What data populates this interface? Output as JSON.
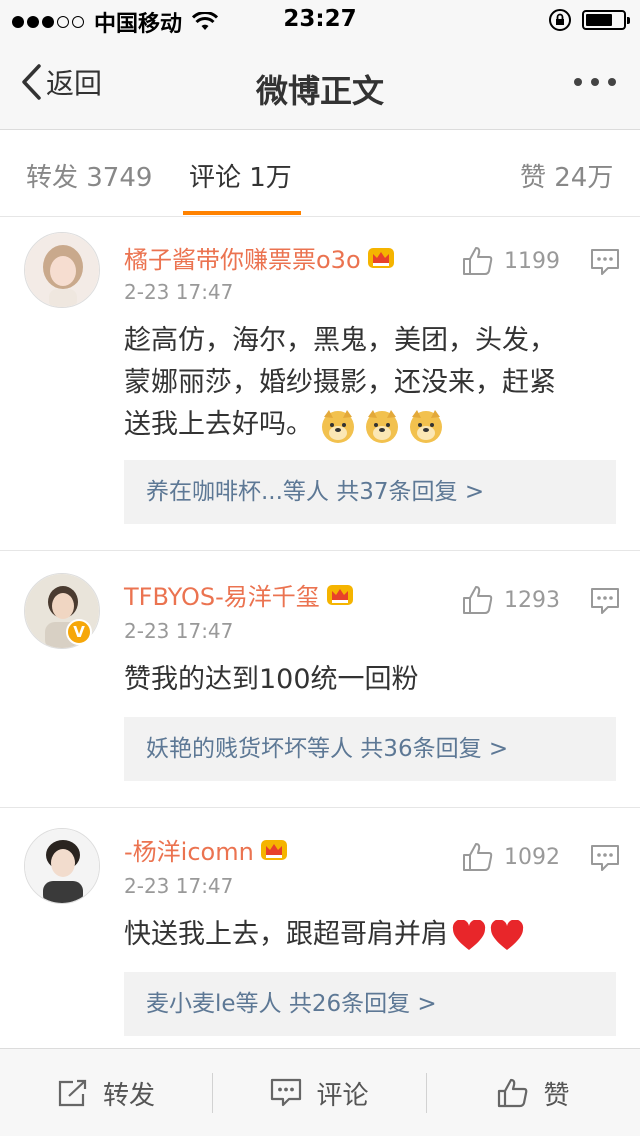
{
  "status_bar": {
    "carrier": "中国移动",
    "time": "23:27"
  },
  "nav": {
    "back_label": "返回",
    "title": "微博正文"
  },
  "tabs": {
    "repost": "转发 3749",
    "comment": "评论 1万",
    "like": "赞 24万"
  },
  "comments": [
    {
      "username": "橘子酱带你赚票票o3o",
      "time": "2-23 17:47",
      "likes": "1199",
      "text_lines": [
        "趁高仿，海尔，黑鬼，美团，头发，",
        "蒙娜丽莎，婚纱摄影，还没来，赶紧",
        "送我上去好吗。"
      ],
      "reply_summary": "养在咖啡杯...等人  共37条回复 >"
    },
    {
      "username": "TFBYOS-易洋千玺",
      "time": "2-23 17:47",
      "likes": "1293",
      "text_lines": [
        "赞我的达到100统一回粉"
      ],
      "reply_summary": "妖艳的贱货坏坏等人  共36条回复 >",
      "verified": "V"
    },
    {
      "username": "-杨洋icomn",
      "time": "2-23 17:47",
      "likes": "1092",
      "text_lines": [
        "快送我上去，跟超哥肩并肩"
      ],
      "reply_summary": "麦小麦le等人  共26条回复 >"
    }
  ],
  "toolbar": {
    "repost": "转发",
    "comment": "评论",
    "like": "赞"
  },
  "colors": {
    "accent": "#ff8200",
    "username": "#eb7350",
    "link": "#5d7895"
  }
}
